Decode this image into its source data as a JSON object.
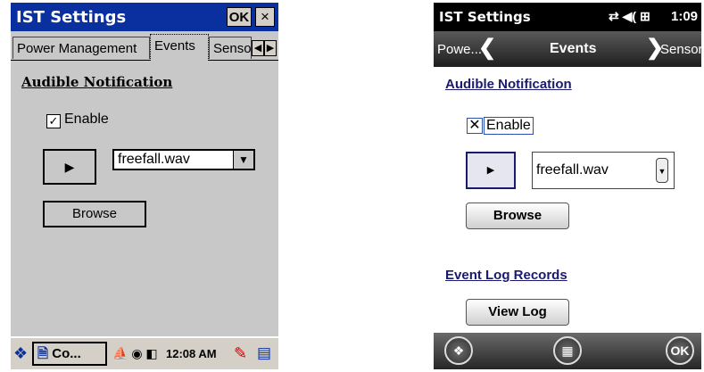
{
  "left": {
    "title": "IST Settings",
    "ok_label": "OK",
    "close_glyph": "×",
    "tabs": [
      "Power Management",
      "Events",
      "Senso"
    ],
    "tab_prev_glyph": "◀",
    "tab_next_glyph": "▶",
    "section_heading": "Audible Notification",
    "enable": {
      "label": "Enable",
      "checked": true,
      "glyph": "✓"
    },
    "play_glyph": "▶",
    "sound_select": {
      "value": "freefall.wav",
      "arrow_glyph": "▼"
    },
    "browse_label": "Browse",
    "taskbar": {
      "start_glyph": "❖",
      "app_icon_glyph": "🗎",
      "app_label": "Co...",
      "tray_glyphs": "⛵ ◉ ◧",
      "time": "12:08 AM",
      "pen_glyph": "✎",
      "desktop_glyph": "▤"
    }
  },
  "right": {
    "status_bar": {
      "title": "IST Settings",
      "icons": "⇄ ◀( ⊞",
      "time": "1:09"
    },
    "nav": {
      "prev_label": "Powe...",
      "prev_glyph": "❮",
      "title": "Events",
      "next_glyph": "❯",
      "next_label": "Sensor"
    },
    "section_heading": "Audible Notification",
    "enable": {
      "label": "Enable",
      "checked": true,
      "glyph": "✕"
    },
    "play_glyph": "▶",
    "sound_select": {
      "value": "freefall.wav",
      "arrow_glyph": "▼"
    },
    "browse_label": "Browse",
    "log_heading": "Event Log Records",
    "view_log_label": "View Log",
    "bottom_bar": {
      "start_glyph": "❖",
      "keyboard_glyph": "▦",
      "ok_label": "OK"
    }
  }
}
